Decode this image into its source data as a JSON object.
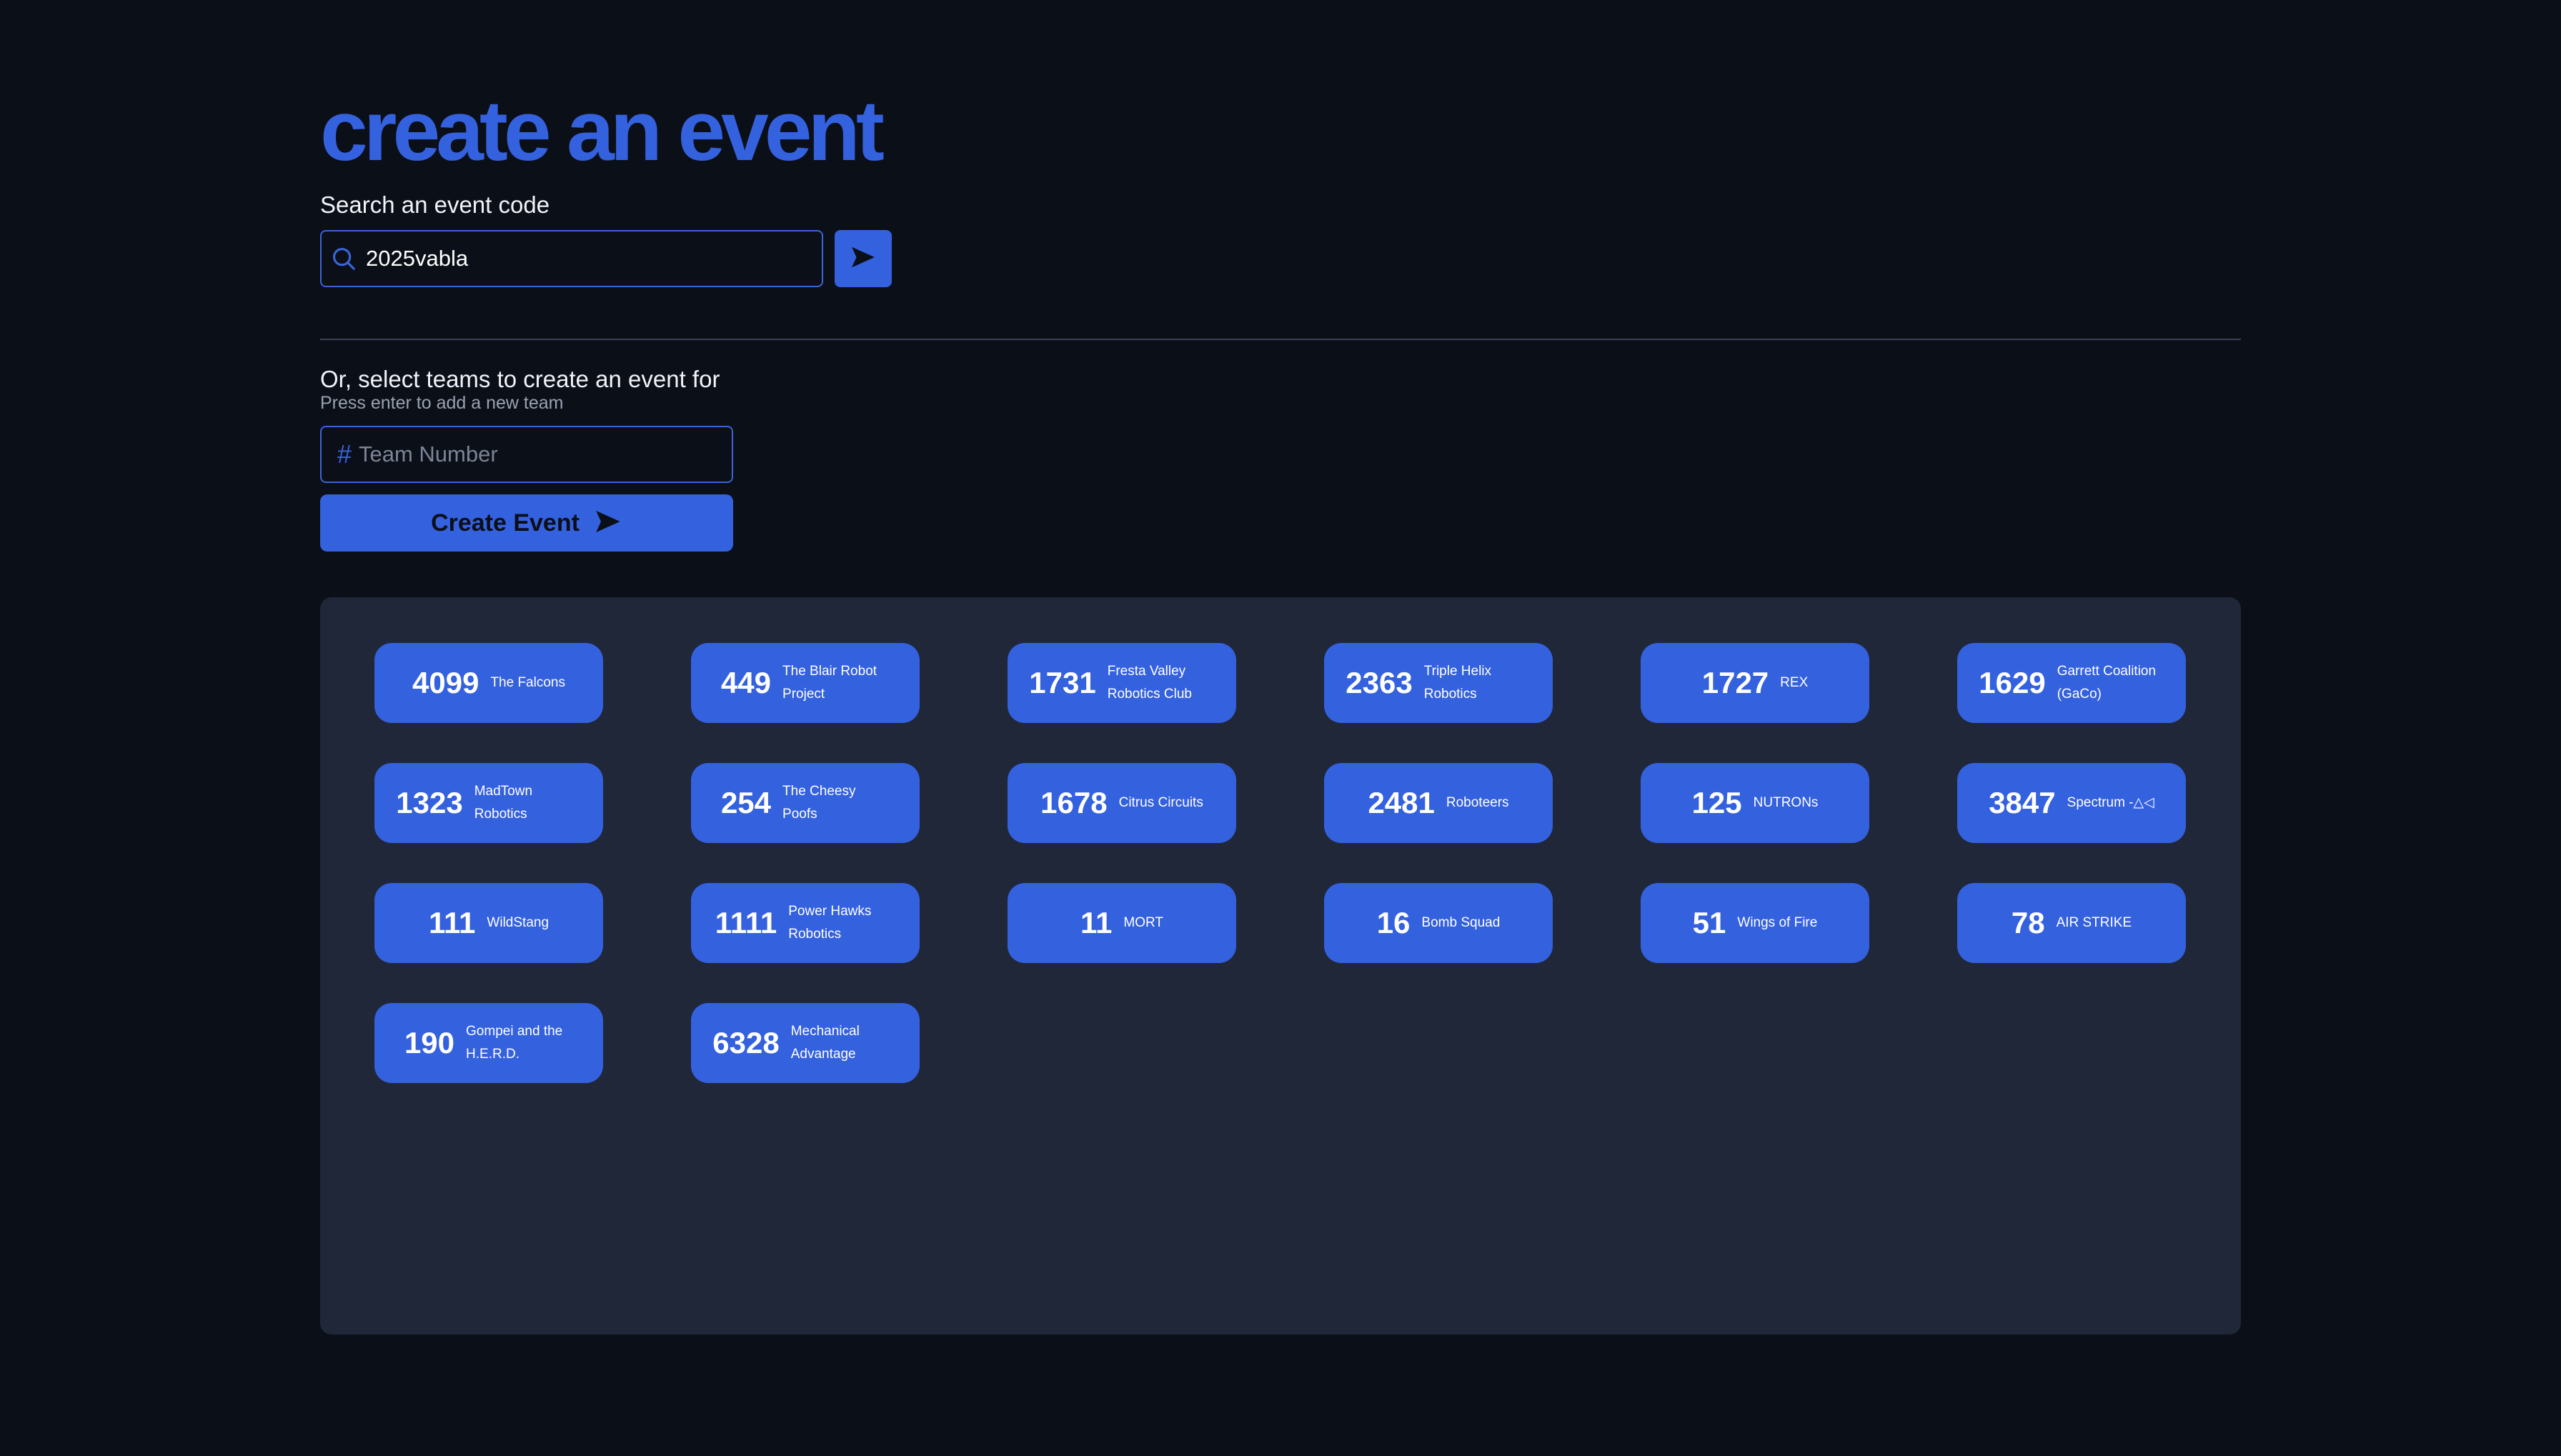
{
  "header": {
    "title": "create an event"
  },
  "search": {
    "label": "Search an event code",
    "value": "2025vabla",
    "icon": "search-icon"
  },
  "select_section": {
    "label": "Or, select teams to create an event for",
    "hint": "Press enter to add a new team",
    "team_input_placeholder": "Team Number",
    "hash_symbol": "#",
    "create_button_label": "Create Event"
  },
  "teams": [
    {
      "number": "4099",
      "name": "The Falcons"
    },
    {
      "number": "449",
      "name": "The Blair Robot Project"
    },
    {
      "number": "1731",
      "name": "Fresta Valley Robotics Club"
    },
    {
      "number": "2363",
      "name": "Triple Helix Robotics"
    },
    {
      "number": "1727",
      "name": "REX"
    },
    {
      "number": "1629",
      "name": "Garrett Coalition (GaCo)"
    },
    {
      "number": "1323",
      "name": "MadTown Robotics"
    },
    {
      "number": "254",
      "name": "The Cheesy Poofs"
    },
    {
      "number": "1678",
      "name": "Citrus Circuits"
    },
    {
      "number": "2481",
      "name": "Roboteers"
    },
    {
      "number": "125",
      "name": "NUTRONs"
    },
    {
      "number": "3847",
      "name": "Spectrum -△◁"
    },
    {
      "number": "111",
      "name": "WildStang"
    },
    {
      "number": "1111",
      "name": "Power Hawks Robotics"
    },
    {
      "number": "11",
      "name": "MORT"
    },
    {
      "number": "16",
      "name": "Bomb Squad"
    },
    {
      "number": "51",
      "name": "Wings of Fire"
    },
    {
      "number": "78",
      "name": "AIR STRIKE"
    },
    {
      "number": "190",
      "name": "Gompei and the H.E.R.D."
    },
    {
      "number": "6328",
      "name": "Mechanical Advantage"
    }
  ],
  "colors": {
    "background": "#0b0f18",
    "accent": "#3461de",
    "panel": "#1f2738"
  }
}
